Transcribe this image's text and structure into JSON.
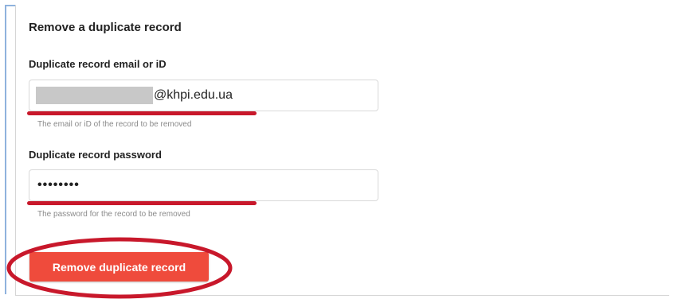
{
  "form": {
    "title": "Remove a duplicate record",
    "email_label": "Duplicate record email or iD",
    "email_value": "@khpi.edu.ua",
    "email_help": "The email or iD of the record to be removed",
    "password_label": "Duplicate record password",
    "password_value": "••••••••",
    "password_help": "The password for the record to be removed",
    "submit_label": "Remove duplicate record"
  },
  "colors": {
    "button": "#ef4b3c",
    "annotation": "#c8182b"
  }
}
